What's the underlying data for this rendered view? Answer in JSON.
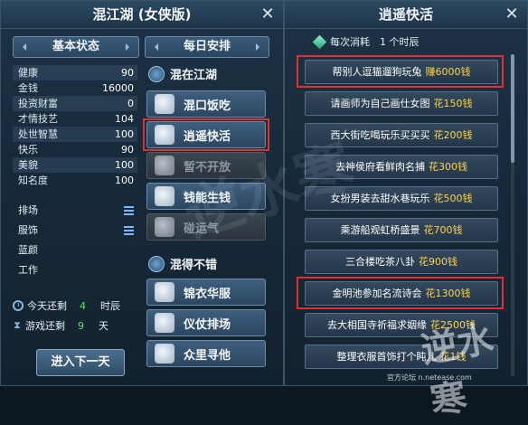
{
  "left_window": {
    "title": "混江湖 (女侠版)",
    "close_label": "✕",
    "basic_status_header": "基本状态",
    "daily_schedule_header": "每日安排",
    "stats": [
      {
        "label": "健康",
        "value": "90"
      },
      {
        "label": "金钱",
        "value": "16000"
      },
      {
        "label": "投资财富",
        "value": "0"
      },
      {
        "label": "才情技艺",
        "value": "104"
      },
      {
        "label": "处世智慧",
        "value": "100"
      },
      {
        "label": "快乐",
        "value": "90"
      },
      {
        "label": "美貌",
        "value": "100"
      },
      {
        "label": "知名度",
        "value": "100"
      }
    ],
    "extras": [
      {
        "label": "排场"
      },
      {
        "label": "服饰"
      },
      {
        "label": "蓝颜"
      },
      {
        "label": "工作"
      }
    ],
    "counters": {
      "remaining_today_label": "今天还剩",
      "remaining_today_value": "4",
      "remaining_today_unit": "时辰",
      "remaining_game_label": "游戏还剩",
      "remaining_game_value": "9",
      "remaining_game_unit": "天"
    },
    "next_day_button": "进入下一天",
    "categories": {
      "hunjianghu": "混在江湖",
      "hundebucuo": "混得不错"
    },
    "actions": [
      {
        "label": "混口饭吃",
        "icon": "bowl-icon",
        "enabled": true
      },
      {
        "label": "逍遥快活",
        "icon": "teapot-icon",
        "enabled": true
      },
      {
        "label": "暂不开放",
        "icon": "boat-icon",
        "enabled": false
      },
      {
        "label": "钱能生钱",
        "icon": "money-icon",
        "enabled": true
      },
      {
        "label": "碰运气",
        "icon": "dice-icon",
        "enabled": false
      },
      {
        "label": "锦衣华服",
        "icon": "robe-icon",
        "enabled": true
      },
      {
        "label": "仪仗排场",
        "icon": "horse-icon",
        "enabled": true
      },
      {
        "label": "众里寻他",
        "icon": "flower-icon",
        "enabled": true
      }
    ]
  },
  "right_window": {
    "title": "逍遥快活",
    "close_label": "✕",
    "cost_text": "每次消耗　1 个时辰",
    "tasks": [
      {
        "desc": "帮别人逗猫遛狗玩兔",
        "price": "赚6000钱"
      },
      {
        "desc": "请画师为自己画仕女图",
        "price": "花150钱"
      },
      {
        "desc": "西大街吃喝玩乐买买买",
        "price": "花200钱"
      },
      {
        "desc": "去神侯府看鲜肉名捕",
        "price": "花300钱"
      },
      {
        "desc": "女扮男装去甜水巷玩乐",
        "price": "花500钱"
      },
      {
        "desc": "乘游船观虹桥盛景",
        "price": "花700钱"
      },
      {
        "desc": "三合楼吃茶八卦",
        "price": "花900钱"
      },
      {
        "desc": "金明池参加名流诗会",
        "price": "花1300钱"
      },
      {
        "desc": "去大相国寺祈福求姻缘",
        "price": "花2500钱"
      },
      {
        "desc": "整理衣服首饰打个盹儿",
        "price": "花1钱"
      }
    ]
  },
  "footer": {
    "forum_note": "官方论坛 n.netease.com",
    "watermark_text": "逆水寒"
  },
  "colors": {
    "highlight": "#e03030",
    "price": "#ffd34a",
    "count": "#5fe05f",
    "accent": "#79b8ff"
  }
}
